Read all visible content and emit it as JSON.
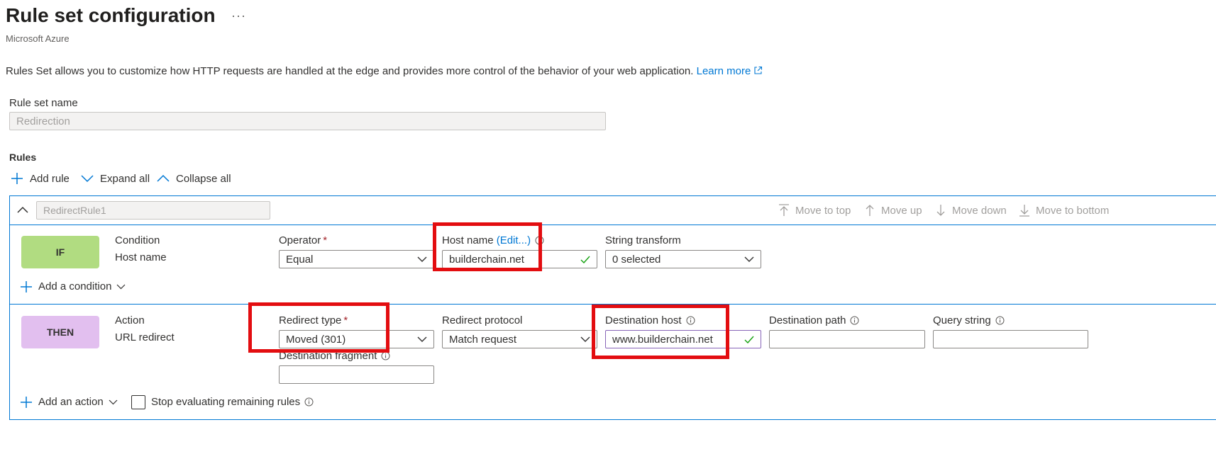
{
  "header": {
    "title": "Rule set configuration",
    "more_label": "···",
    "subtitle": "Microsoft Azure"
  },
  "description": {
    "text": "Rules Set allows you to customize how HTTP requests are handled at the edge and provides more control of the behavior of your web application.",
    "learn_more": "Learn more"
  },
  "rule_set_name": {
    "label": "Rule set name",
    "value": "Redirection"
  },
  "rules": {
    "heading": "Rules",
    "add_rule": "Add rule",
    "expand_all": "Expand all",
    "collapse_all": "Collapse all",
    "rule_name": "RedirectRule1",
    "move_to_top": "Move to top",
    "move_up": "Move up",
    "move_down": "Move down",
    "move_to_bottom": "Move to bottom"
  },
  "condition": {
    "badge": "IF",
    "title": "Condition",
    "type": "Host name",
    "operator_label": "Operator",
    "operator_value": "Equal",
    "host_name_label": "Host name",
    "edit_label": "(Edit...)",
    "host_name_value": "builderchain.net",
    "string_transform_label": "String transform",
    "string_transform_value": "0 selected",
    "add_condition": "Add a condition"
  },
  "action": {
    "badge": "THEN",
    "title": "Action",
    "type": "URL redirect",
    "redirect_type_label": "Redirect type",
    "redirect_type_value": "Moved (301)",
    "redirect_protocol_label": "Redirect protocol",
    "redirect_protocol_value": "Match request",
    "destination_host_label": "Destination host",
    "destination_host_value": "www.builderchain.net",
    "destination_path_label": "Destination path",
    "destination_path_value": "",
    "query_string_label": "Query string",
    "query_string_value": "",
    "destination_fragment_label": "Destination fragment",
    "destination_fragment_value": "",
    "add_action": "Add an action",
    "stop_evaluating": "Stop evaluating remaining rules"
  },
  "colors": {
    "accent": "#0078d4",
    "highlight": "#e30d10",
    "if_badge": "#b1dc81",
    "then_badge": "#e2bfef",
    "valid_check": "#13a10e"
  }
}
